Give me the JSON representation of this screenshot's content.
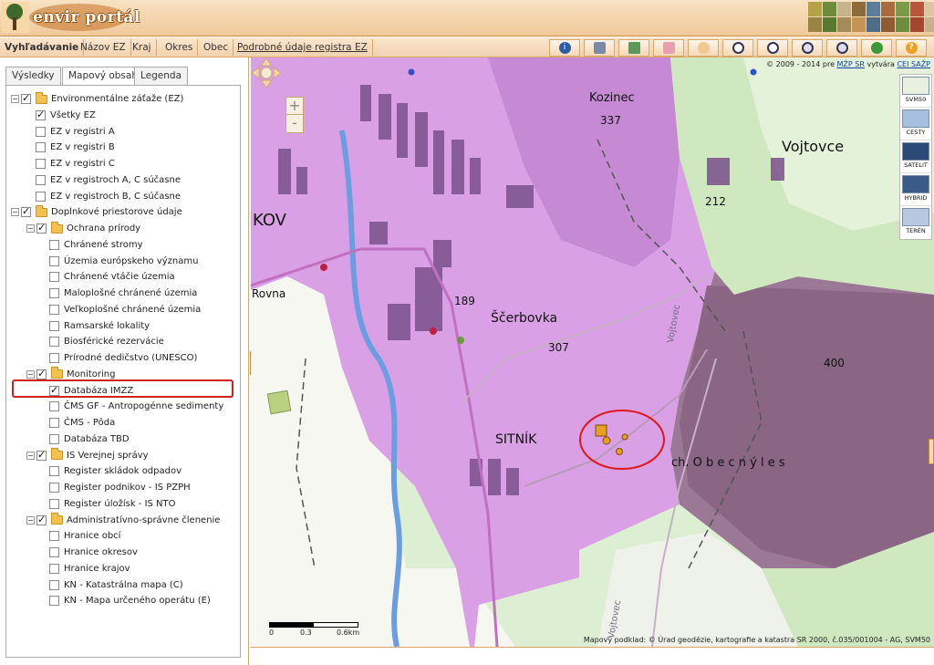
{
  "header": {
    "logo_text": "envir portál"
  },
  "nav": {
    "tabs": [
      "Vyhľadávanie",
      "Názov EZ",
      "Kraj",
      "Okres",
      "Obec",
      "Podrobné údaje registra EZ"
    ],
    "tools": [
      "info-icon",
      "print-icon",
      "measure-icon",
      "eraser-icon",
      "pan-hand-icon",
      "zoom-in-icon",
      "zoom-out-icon",
      "zoom-prev-icon",
      "zoom-next-icon",
      "full-extent-icon",
      "help-icon"
    ]
  },
  "panel": {
    "tabs": [
      "Výsledky",
      "Mapový obsah",
      "Legenda"
    ],
    "tree": [
      {
        "label": "Environmentálne záťaže (EZ)",
        "level": 0,
        "checked": true,
        "folder": true
      },
      {
        "label": "Všetky EZ",
        "level": 1,
        "checked": true
      },
      {
        "label": "EZ v registri A",
        "level": 1,
        "checked": false
      },
      {
        "label": "EZ v registri B",
        "level": 1,
        "checked": false
      },
      {
        "label": "EZ v registri C",
        "level": 1,
        "checked": false
      },
      {
        "label": "EZ v registroch A, C súčasne",
        "level": 1,
        "checked": false
      },
      {
        "label": "EZ v registroch B, C súčasne",
        "level": 1,
        "checked": false
      },
      {
        "label": "Doplnkové priestorove údaje",
        "level": 0,
        "checked": true,
        "folder": true
      },
      {
        "label": "Ochrana prírody",
        "level": 1,
        "checked": true,
        "folder": true
      },
      {
        "label": "Chránené stromy",
        "level": 2,
        "checked": false
      },
      {
        "label": "Územia európskeho významu",
        "level": 2,
        "checked": false
      },
      {
        "label": "Chránené vtáčie územia",
        "level": 2,
        "checked": false
      },
      {
        "label": "Maloplošné chránené územia",
        "level": 2,
        "checked": false
      },
      {
        "label": "Veľkoplošné chránené územia",
        "level": 2,
        "checked": false
      },
      {
        "label": "Ramsarské lokality",
        "level": 2,
        "checked": false
      },
      {
        "label": "Biosférické rezervácie",
        "level": 2,
        "checked": false
      },
      {
        "label": "Prírodné dedičstvo (UNESCO)",
        "level": 2,
        "checked": false
      },
      {
        "label": "Monitoring",
        "level": 1,
        "checked": true,
        "folder": true
      },
      {
        "label": "Databáza IMZZ",
        "level": 2,
        "checked": true
      },
      {
        "label": "ČMS GF - Antropogénne sedimenty",
        "level": 2,
        "checked": false
      },
      {
        "label": "ČMS - Pôda",
        "level": 2,
        "checked": false
      },
      {
        "label": "Databáza TBD",
        "level": 2,
        "checked": false
      },
      {
        "label": "IS Verejnej správy",
        "level": 1,
        "checked": true,
        "folder": true
      },
      {
        "label": "Register skládok odpadov",
        "level": 2,
        "checked": false
      },
      {
        "label": "Register podnikov - IS PZPH",
        "level": 2,
        "checked": false
      },
      {
        "label": "Register úložísk - IS NTO",
        "level": 2,
        "checked": false
      },
      {
        "label": "Administratívno-správne členenie",
        "level": 1,
        "checked": true,
        "folder": true
      },
      {
        "label": "Hranice obcí",
        "level": 2,
        "checked": false
      },
      {
        "label": "Hranice okresov",
        "level": 2,
        "checked": false
      },
      {
        "label": "Hranice krajov",
        "level": 2,
        "checked": false
      },
      {
        "label": "KN - Katastrálna mapa (C)",
        "level": 2,
        "checked": false
      },
      {
        "label": "KN - Mapa určeného operátu (E)",
        "level": 2,
        "checked": false
      }
    ]
  },
  "map": {
    "copyright_prefix": "© 2009 - 2014 pre",
    "copyright_org1": "MŽP SR",
    "copyright_mid": "vytvára",
    "copyright_org2": "CEI SAŽP",
    "zoom_in": "+",
    "zoom_out": "-",
    "types": [
      "SVM50",
      "CESTY",
      "SATELIT",
      "HYBRID",
      "TERÉN"
    ],
    "labels": {
      "kozinec": "Kozinec",
      "h337": "337",
      "vojtovce": "Vojtovce",
      "h212": "212",
      "kov": "KOV",
      "rovna": "Rovna",
      "h189": "189",
      "scerbovka": "Ščerbovka",
      "h307": "307",
      "h400": "400",
      "sitnik": "SITNÍK",
      "obecny_les": "ch. O b e c n ý   l e s",
      "vojtovec1": "Vojtovec",
      "vojtovec2": "Vojtovec"
    },
    "scale": {
      "s0": "0",
      "s1": "0.3",
      "s2": "0.6km"
    },
    "attribution": "Mapový podklad: © Úrad geodézie, kartografie a katastra SR 2000, č.035/001004 - AG, SVM50"
  },
  "colors": {
    "accent": "#f0c99a",
    "map_pink": "#d9a0e6",
    "map_dark": "#8d6e86",
    "highlight": "#d02020"
  }
}
